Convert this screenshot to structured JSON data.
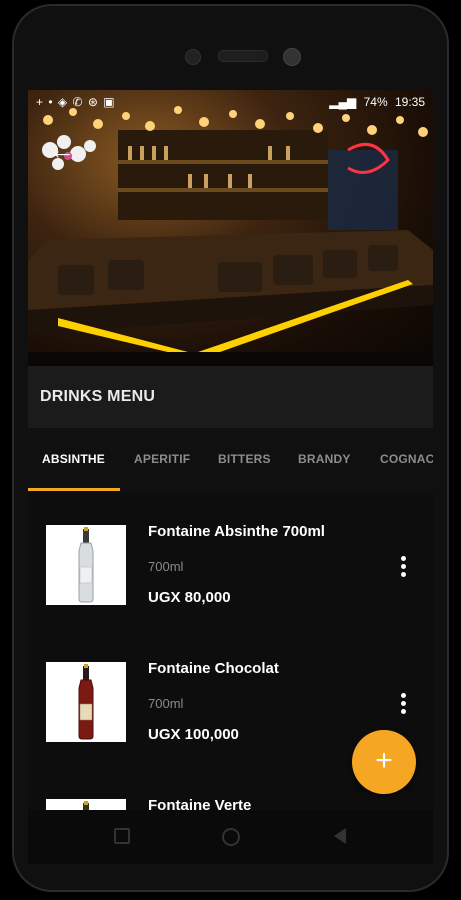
{
  "status": {
    "left_icons": "+ • ◈ ✆ ⊛ ▣",
    "battery": "74%",
    "time": "19:35"
  },
  "header": {
    "back_icon": "arrow-left-icon",
    "title": "DRINKS MENU"
  },
  "tabs": [
    {
      "label": "ABSINTHE",
      "active": true
    },
    {
      "label": "APERITIF",
      "active": false
    },
    {
      "label": "BITTERS",
      "active": false
    },
    {
      "label": "BRANDY",
      "active": false
    },
    {
      "label": "COGNAC",
      "active": false
    }
  ],
  "products": [
    {
      "name": "Fontaine Absinthe 700ml",
      "size": "700ml",
      "price": "UGX 80,000"
    },
    {
      "name": "Fontaine Chocolat",
      "size": "700ml",
      "price": "UGX 100,000"
    },
    {
      "name": "Fontaine Verte",
      "size": "",
      "price": ""
    }
  ],
  "fab": {
    "label": "+"
  },
  "colors": {
    "accent": "#f5a623",
    "background": "#0d0d0d",
    "title_bar": "#1b1b1b"
  }
}
